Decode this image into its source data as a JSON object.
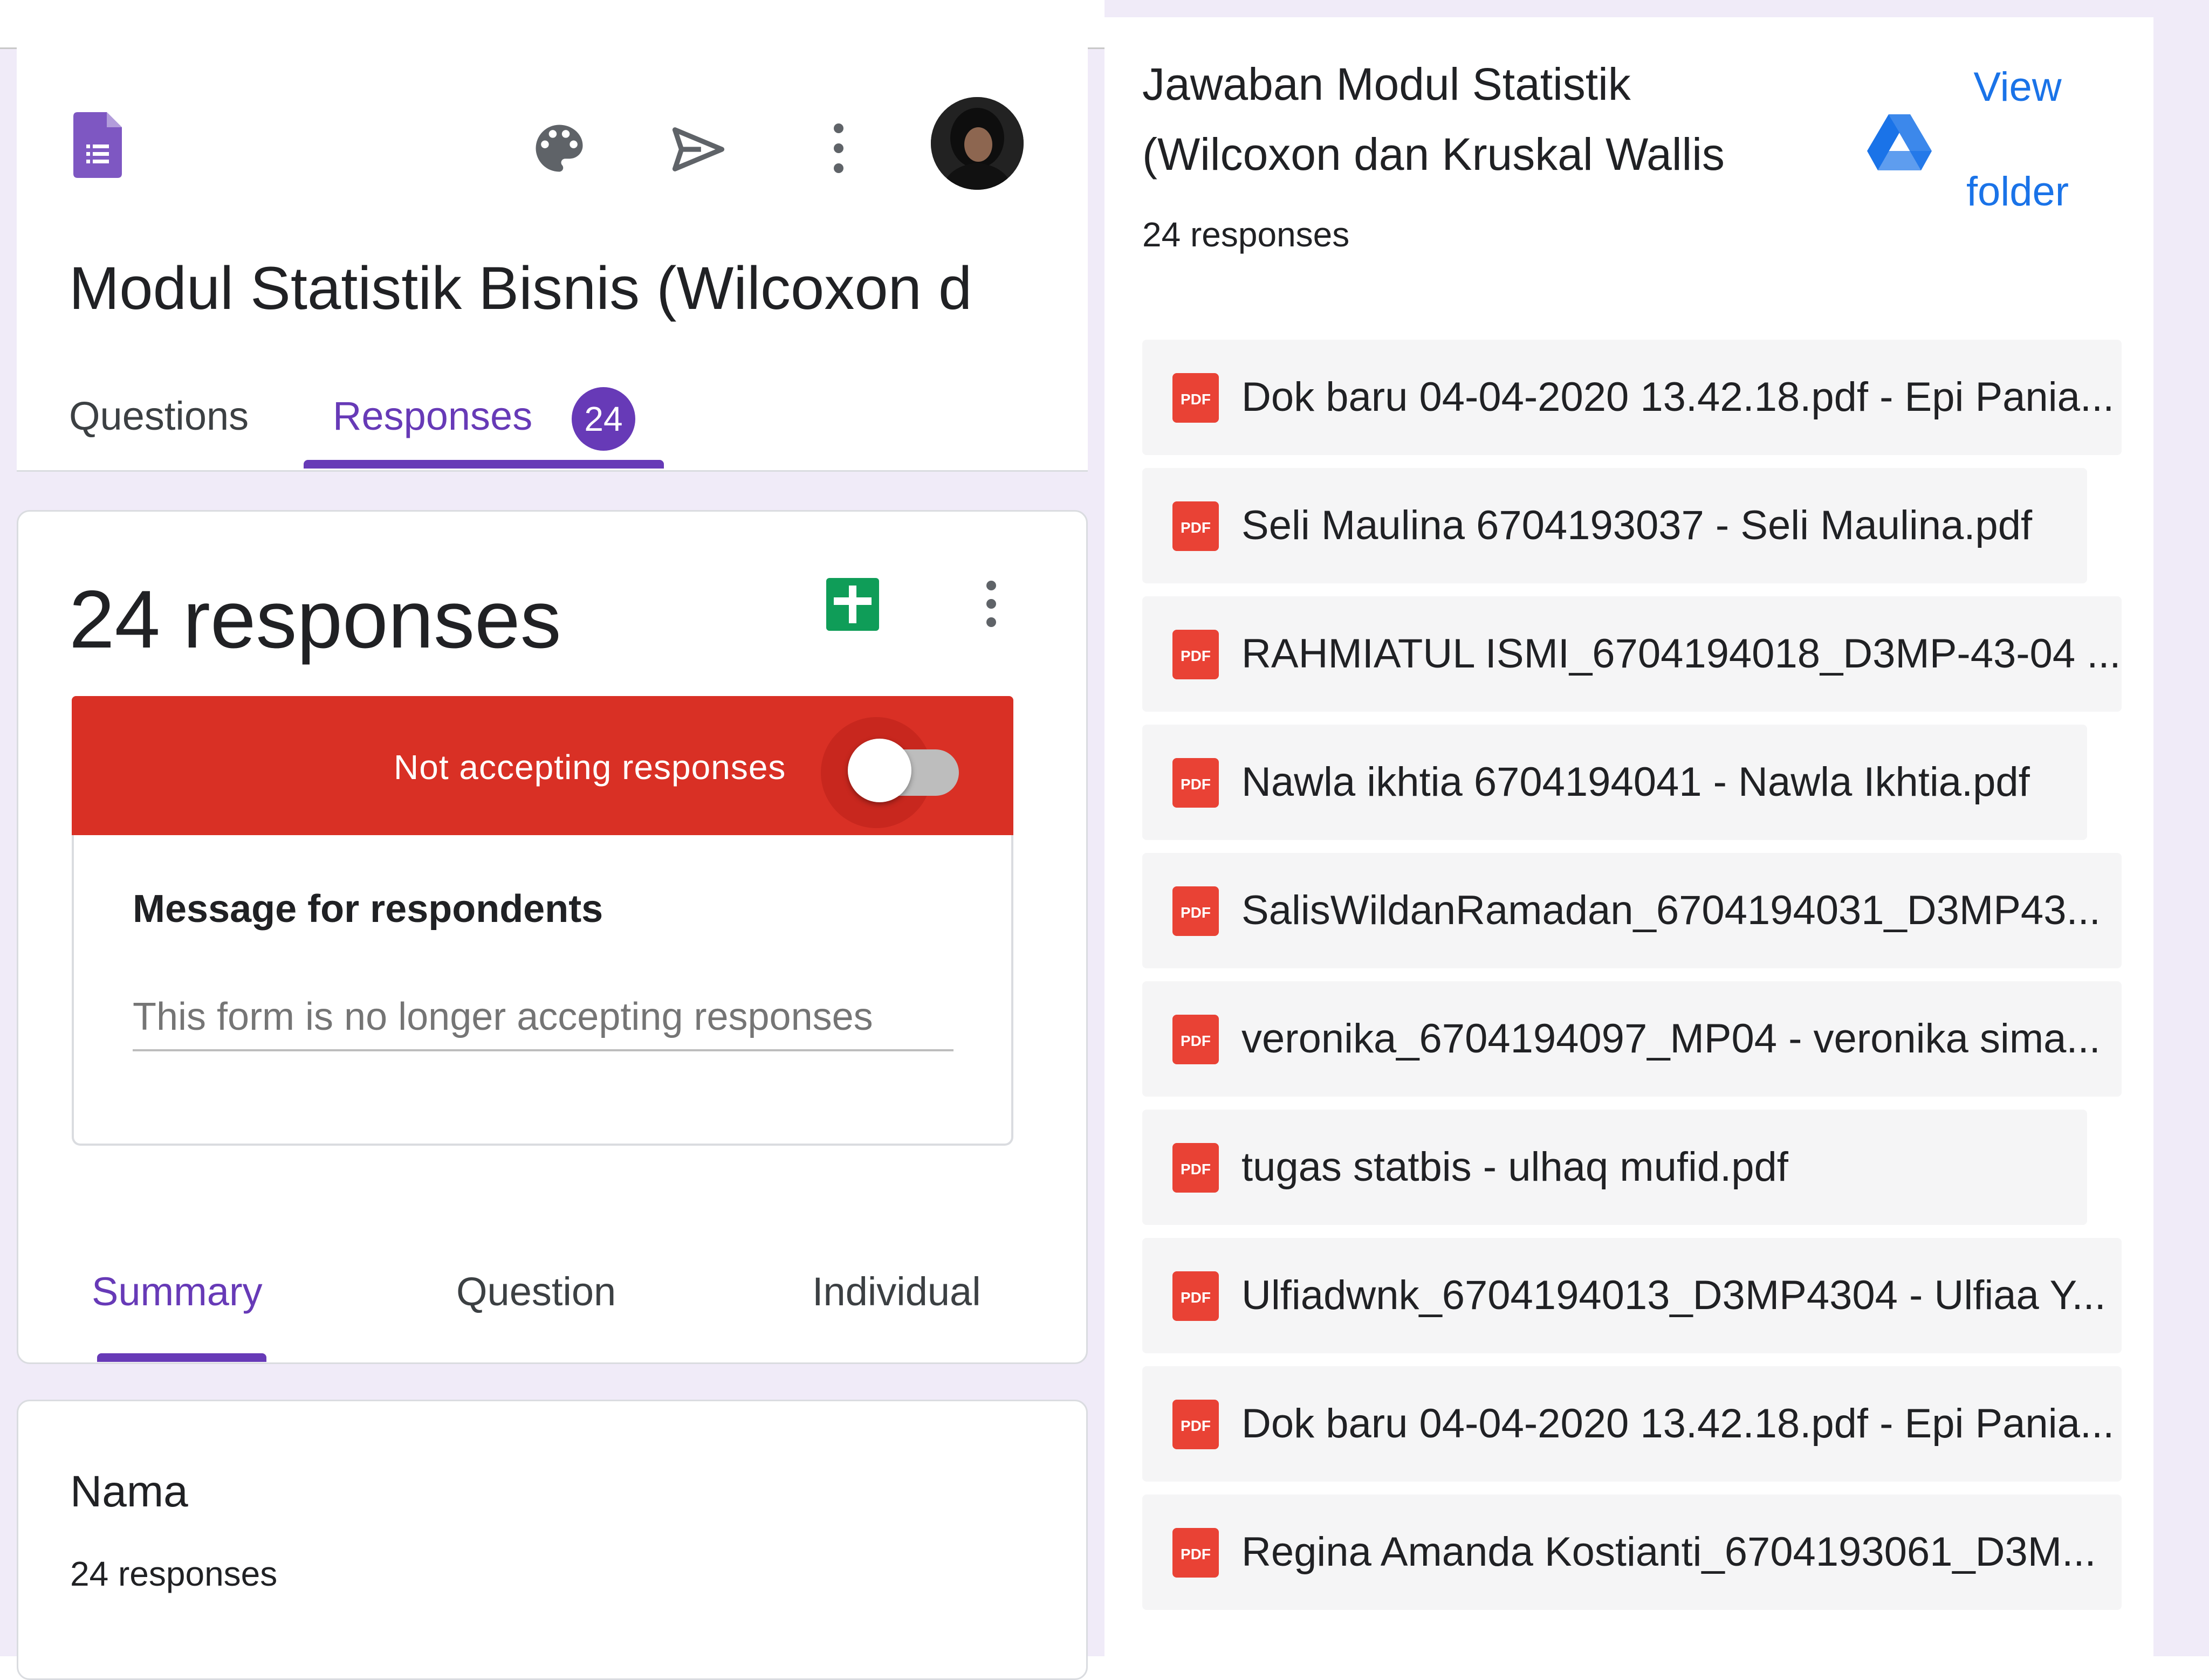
{
  "form": {
    "title": "Modul Statistik Bisnis (Wilcoxon d",
    "tabs": {
      "questions": "Questions",
      "responses": "Responses",
      "responses_badge": "24"
    },
    "avatar_label": "account-avatar"
  },
  "responses_card": {
    "count_label": "24 responses",
    "banner_label": "Not accepting responses",
    "accepting_responses": false,
    "message_title": "Message for respondents",
    "message_placeholder": "This form is no longer accepting responses",
    "subtabs": {
      "summary": "Summary",
      "question": "Question",
      "individual": "Individual"
    }
  },
  "question_card": {
    "title": "Nama",
    "count_label": "24 responses"
  },
  "drive_panel": {
    "title_line_1": "Jawaban Modul Statistik",
    "title_line_2": "(Wilcoxon dan Kruskal Wallis",
    "count_label": "24 responses",
    "view_folder_1": "View",
    "view_folder_2": "folder",
    "files": [
      "Dok baru 04-04-2020 13.42.18.pdf - Epi Pania...",
      "Seli Maulina 6704193037 - Seli Maulina.pdf",
      "RAHMIATUL ISMI_6704194018_D3MP-43-04 ...",
      "Nawla ikhtia 6704194041 - Nawla Ikhtia.pdf",
      "SalisWildanRamadan_6704194031_D3MP43...",
      "veronika_6704194097_MP04 - veronika sima...",
      "tugas statbis - ulhaq mufid.pdf",
      "Ulfiadwnk_6704194013_D3MP4304 - Ulfiaa Y...",
      "Dok baru 04-04-2020 13.42.18.pdf - Epi Pania...",
      "Regina Amanda Kostianti_6704193061_D3M..."
    ],
    "pdf_icon_text": "PDF"
  },
  "colors": {
    "accent": "#673ab7",
    "banner_red": "#d93025",
    "link_blue": "#1a73e8",
    "sheets_green": "#0f9d58",
    "pdf_red": "#e94235"
  }
}
